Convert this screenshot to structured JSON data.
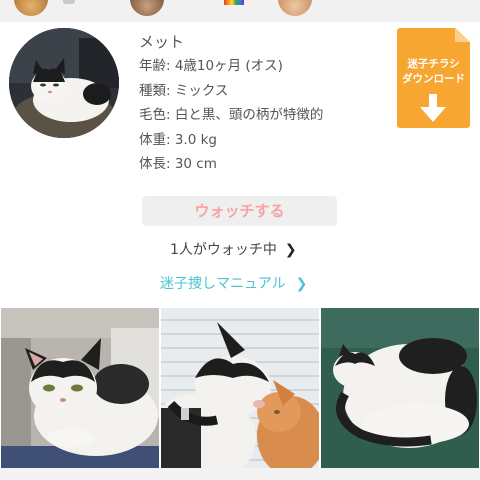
{
  "profile": {
    "name": "メット",
    "age": "年齢: 4歳10ヶ月 (オス)",
    "breed": "種類: ミックス",
    "coat": "毛色: 白と黒、頭の柄が特徴的",
    "weight": "体重: 3.0 kg",
    "length": "体長: 30 cm"
  },
  "flyer": {
    "line1": "迷子チラシ",
    "line2": "ダウンロード",
    "icon": "download-arrow-icon"
  },
  "watch": {
    "button_label": "ウォッチする",
    "watchers_text": "1人がウォッチ中",
    "chevron": "❯"
  },
  "manual": {
    "link_text": "迷子捜しマニュアル",
    "chevron": "❯"
  },
  "colors": {
    "flyer": "#f7a631",
    "watch_text": "#f6a3a3",
    "link": "#4bc3d1"
  }
}
